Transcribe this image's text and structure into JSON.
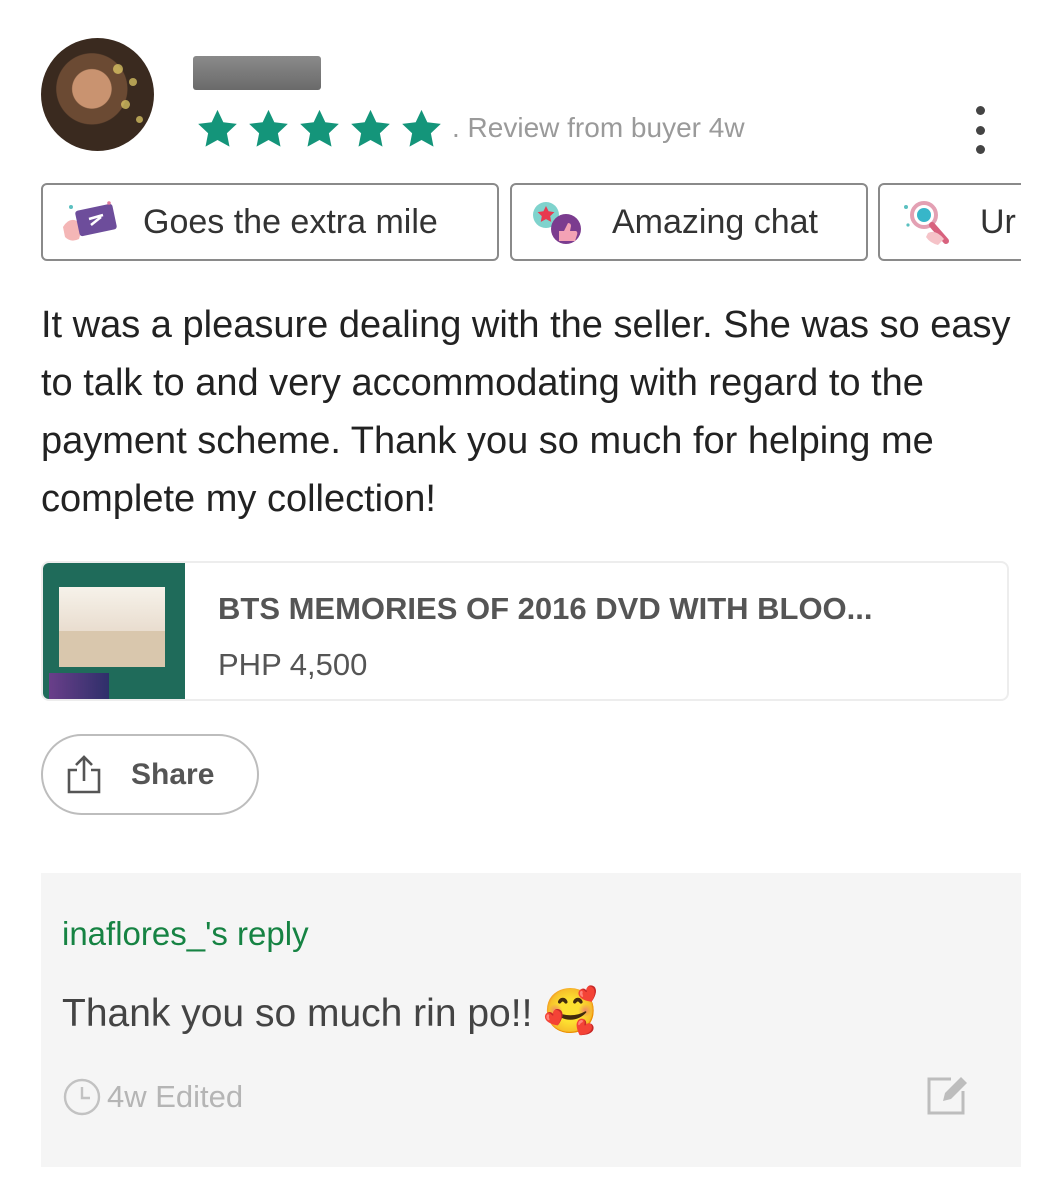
{
  "review": {
    "rating": 5,
    "rating_max": 5,
    "meta": ". Review from buyer  4w",
    "text": "It was a pleasure dealing with the seller. She was so easy to talk to and very accommodating with regard to the payment scheme. Thank you so much for helping me complete my collection!"
  },
  "chips": [
    {
      "label": "Goes the extra mile",
      "icon": "ticket-hand-icon"
    },
    {
      "label": "Amazing chat",
      "icon": "chat-thumbs-up-icon"
    },
    {
      "label": "Ur",
      "icon": "magnifier-hand-icon"
    }
  ],
  "product": {
    "title": "BTS MEMORIES OF 2016 DVD WITH BLOO...",
    "price": "PHP 4,500"
  },
  "share": {
    "label": "Share",
    "icon": "share-icon"
  },
  "reply": {
    "title": "inaflores_'s reply",
    "text": "Thank you so much rin po!!",
    "emoji": "🥰",
    "meta": "4w Edited"
  },
  "colors": {
    "star": "#14957a",
    "reply_title": "#168343",
    "reply_bg": "#f5f5f5"
  }
}
